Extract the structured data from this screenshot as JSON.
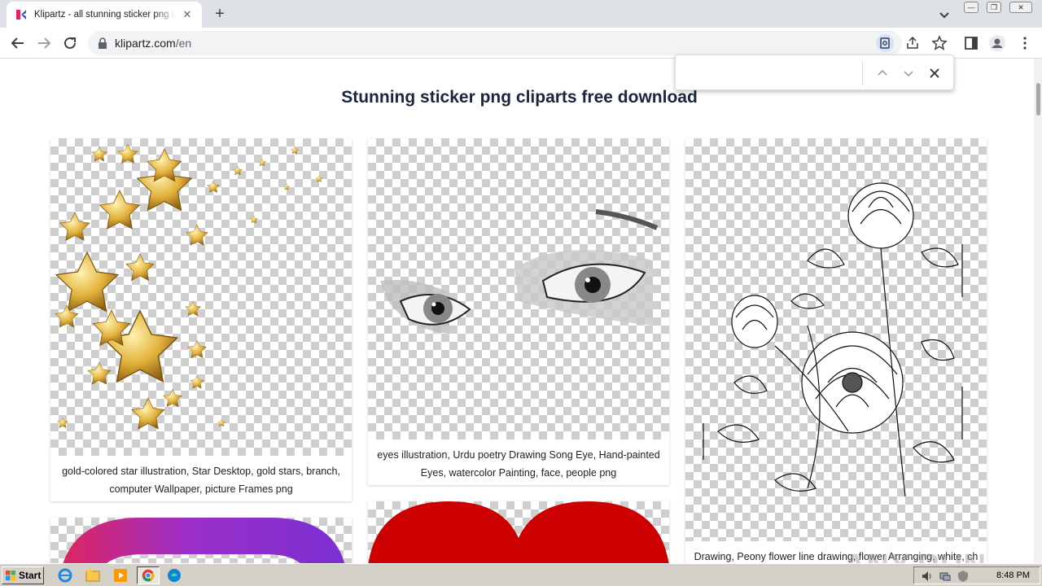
{
  "browser": {
    "tab_title": "Klipartz - all stunning sticker png images",
    "new_tab": "+",
    "url_domain": "klipartz.com",
    "url_path": "/en",
    "find_query": ""
  },
  "page": {
    "heading": "Stunning sticker png cliparts free download",
    "cards": [
      {
        "caption": "gold-colored star illustration, Star Desktop, gold stars, branch, computer Wallpaper, picture Frames png"
      },
      {
        "caption": "eyes illustration, Urdu poetry Drawing Song Eye, Hand-painted Eyes, watercolor Painting, face, people png"
      },
      {
        "caption": "Drawing, Peony flower line drawing, flower Arranging, white, ch"
      }
    ],
    "watermark": "ANY.RUN"
  },
  "taskbar": {
    "start_label": "Start",
    "clock": "8:48 PM"
  },
  "colors": {
    "heading": "#1a2540",
    "heart": "#cc0000",
    "gold": "#e3b23c"
  }
}
